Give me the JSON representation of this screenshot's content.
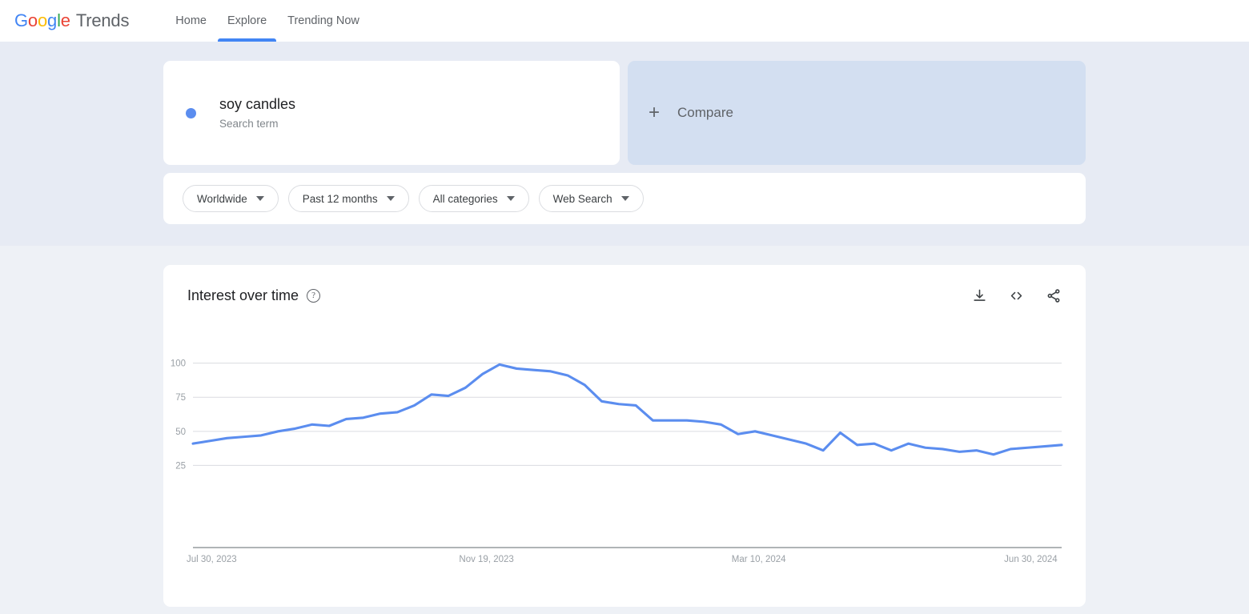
{
  "header": {
    "brand": {
      "g1": "G",
      "o1": "o",
      "o2": "o",
      "g2": "g",
      "l1": "l",
      "e1": "e",
      "trends": "Trends"
    },
    "nav": [
      {
        "label": "Home",
        "active": false
      },
      {
        "label": "Explore",
        "active": true
      },
      {
        "label": "Trending Now",
        "active": false
      }
    ]
  },
  "search_term": {
    "name": "soy candles",
    "type_label": "Search term",
    "dot_color": "#5b8def"
  },
  "compare": {
    "label": "Compare",
    "plus": "+"
  },
  "filters": [
    {
      "label": "Worldwide"
    },
    {
      "label": "Past 12 months"
    },
    {
      "label": "All categories"
    },
    {
      "label": "Web Search"
    }
  ],
  "chart_card": {
    "title": "Interest over time",
    "help_glyph": "?",
    "actions": [
      {
        "name": "download",
        "title": "Download CSV"
      },
      {
        "name": "embed",
        "title": "Embed"
      },
      {
        "name": "share",
        "title": "Share"
      }
    ]
  },
  "chart_data": {
    "type": "line",
    "title": "Interest over time",
    "xlabel": "",
    "ylabel": "",
    "ylim": [
      0,
      108
    ],
    "yticks": [
      25,
      50,
      75,
      100
    ],
    "grid": true,
    "legend": false,
    "line_color": "#5b8def",
    "xtick_labels": [
      "Jul 30, 2023",
      "Nov 19, 2023",
      "Mar 10, 2024",
      "Jun 30, 2024"
    ],
    "xtick_indices": [
      0,
      16,
      32,
      48
    ],
    "series": [
      {
        "name": "soy candles",
        "values": [
          41,
          43,
          45,
          46,
          47,
          50,
          52,
          55,
          54,
          59,
          60,
          63,
          64,
          69,
          77,
          76,
          82,
          92,
          99,
          96,
          95,
          94,
          91,
          84,
          72,
          70,
          69,
          58,
          58,
          58,
          57,
          55,
          48,
          50,
          47,
          44,
          41,
          36,
          49,
          40,
          41,
          36,
          41,
          38,
          37,
          35,
          36,
          33,
          37,
          38,
          39,
          40
        ]
      }
    ]
  }
}
